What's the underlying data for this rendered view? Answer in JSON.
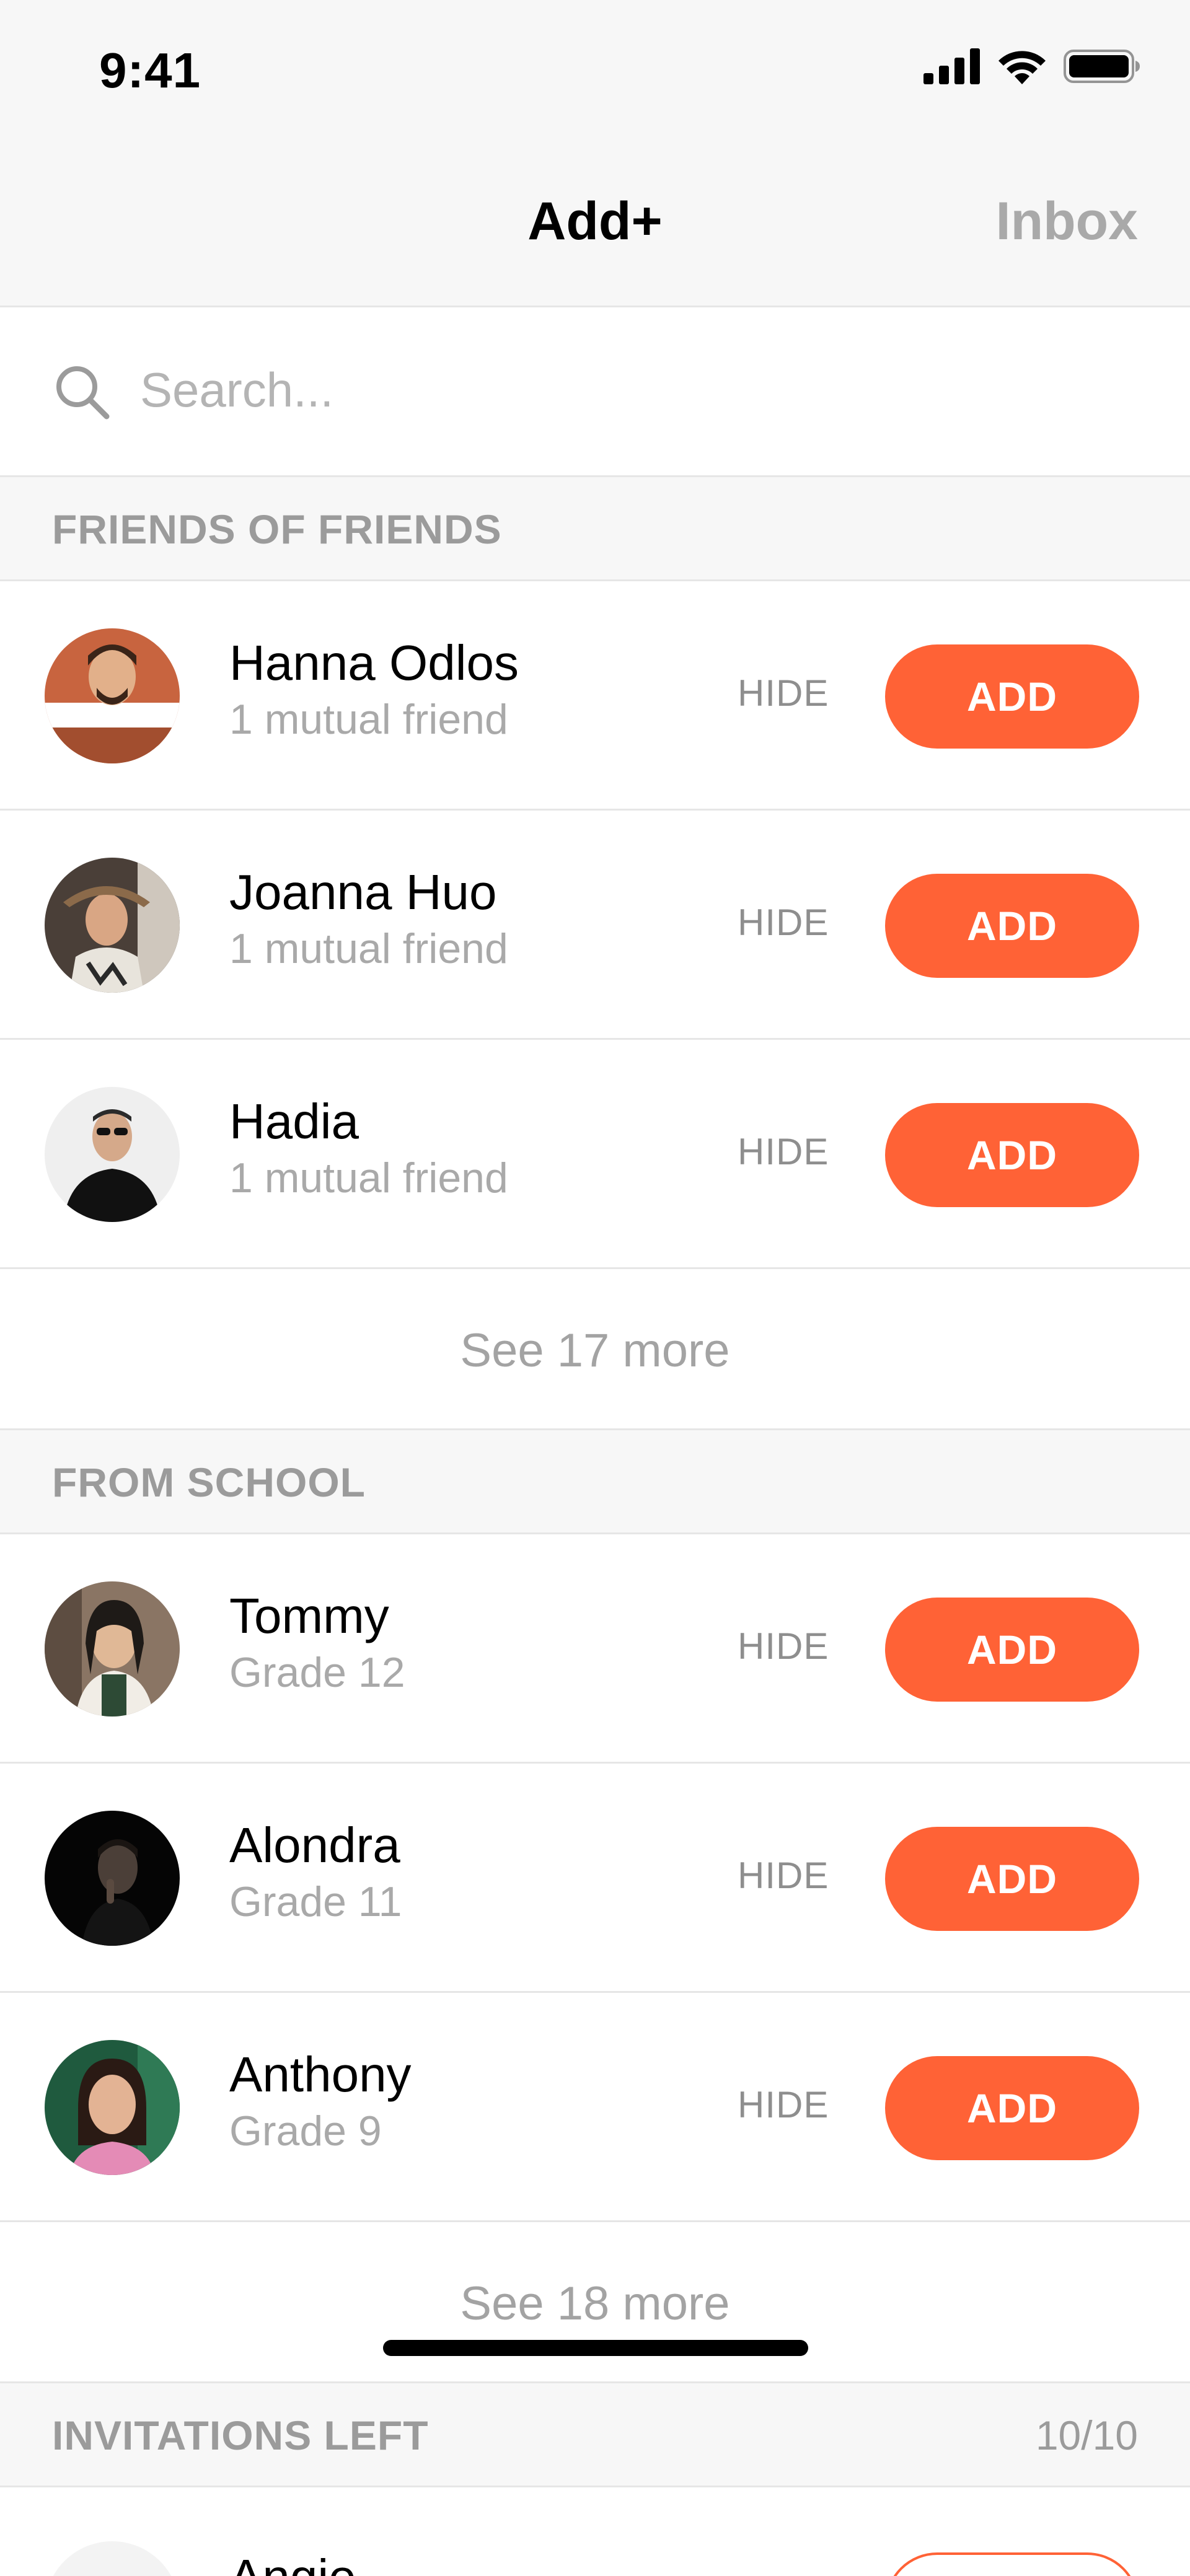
{
  "status_bar": {
    "time": "9:41",
    "icons": [
      "signal-icon",
      "wifi-icon",
      "battery-icon"
    ]
  },
  "nav": {
    "title": "Add+",
    "inbox": "Inbox"
  },
  "search": {
    "placeholder": "Search...",
    "icon": "search-icon"
  },
  "colors": {
    "accent": "#ff6236",
    "muted_text": "#a9a9a9",
    "header_bg": "#f7f7f7"
  },
  "sections": {
    "friends_of_friends": {
      "title": "FRIENDS OF FRIENDS",
      "rows": [
        {
          "name": "Hanna Odlos",
          "sub": "1 mutual friend",
          "hide": "HIDE",
          "add": "ADD"
        },
        {
          "name": "Joanna Huo",
          "sub": "1 mutual friend",
          "hide": "HIDE",
          "add": "ADD"
        },
        {
          "name": "Hadia",
          "sub": "1 mutual friend",
          "hide": "HIDE",
          "add": "ADD"
        }
      ],
      "see_more": "See 17 more"
    },
    "from_school": {
      "title": "FROM SCHOOL",
      "rows": [
        {
          "name": "Tommy",
          "sub": "Grade 12",
          "hide": "HIDE",
          "add": "ADD"
        },
        {
          "name": "Alondra",
          "sub": "Grade 11",
          "hide": "HIDE",
          "add": "ADD"
        },
        {
          "name": "Anthony",
          "sub": "Grade 9",
          "hide": "HIDE",
          "add": "ADD"
        }
      ],
      "see_more": "See 18 more"
    },
    "invitations_left": {
      "title": "INVITATIONS LEFT",
      "count": "10/10",
      "rows": [
        {
          "name": "Angie"
        }
      ]
    }
  }
}
